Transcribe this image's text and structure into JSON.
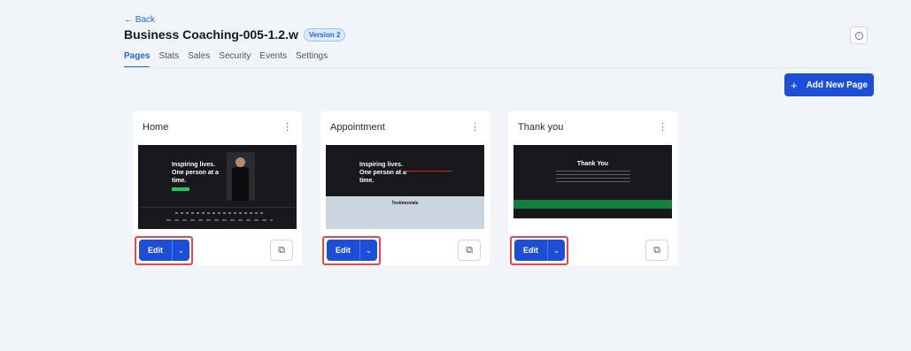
{
  "header": {
    "back_label": "← Back",
    "title": "Business Coaching-005-1.2.w",
    "version_badge": "Version 2",
    "info_icon": "info-icon"
  },
  "tabs": [
    {
      "label": "Pages",
      "active": true
    },
    {
      "label": "Stats",
      "active": false
    },
    {
      "label": "Sales",
      "active": false
    },
    {
      "label": "Security",
      "active": false
    },
    {
      "label": "Events",
      "active": false
    },
    {
      "label": "Settings",
      "active": false
    }
  ],
  "actions": {
    "add_new_page_label": "Add New Page",
    "add_icon": "+"
  },
  "cards": [
    {
      "title": "Home",
      "thumbnail_text": "Inspiring lives. One person at a time.",
      "edit_label": "Edit"
    },
    {
      "title": "Appointment",
      "thumbnail_text": "Inspiring lives. One person at a time.",
      "thumbnail_subtext": "Testimonials",
      "edit_label": "Edit"
    },
    {
      "title": "Thank you",
      "thumbnail_text": "Thank You",
      "edit_label": "Edit"
    }
  ],
  "colors": {
    "accent": "#1d4ed8",
    "highlight": "#ef4444",
    "background": "#f1f5f9"
  }
}
